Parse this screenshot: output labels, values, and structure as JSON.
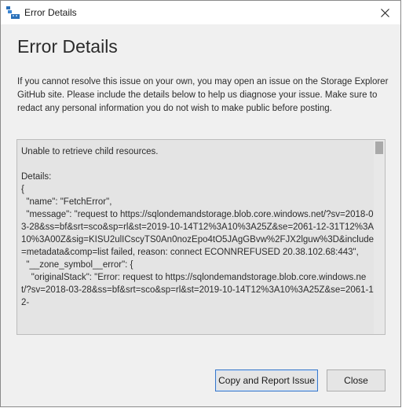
{
  "window": {
    "title": "Error Details"
  },
  "dialog": {
    "heading": "Error Details",
    "intro": "If you cannot resolve this issue on your own, you may open an issue on the Storage Explorer GitHub site. Please include the details below to help us diagnose your issue. Make sure to redact any personal information you do not wish to make public before posting.",
    "details_text": "Unable to retrieve child resources.\n\nDetails:\n{\n  \"name\": \"FetchError\",\n  \"message\": \"request to https://sqlondemandstorage.blob.core.windows.net/?sv=2018-03-28&ss=bf&srt=sco&sp=rl&st=2019-10-14T12%3A10%3A25Z&se=2061-12-31T12%3A10%3A00Z&sig=KISU2ulICscyTS0An0nozEpo4tO5JAgGBvw%2FJX2lguw%3D&include=metadata&comp=list failed, reason: connect ECONNREFUSED 20.38.102.68:443\",\n  \"__zone_symbol__error\": {\n    \"originalStack\": \"Error: request to https://sqlondemandstorage.blob.core.windows.net/?sv=2018-03-28&ss=bf&srt=sco&sp=rl&st=2019-10-14T12%3A10%3A25Z&se=2061-12-"
  },
  "buttons": {
    "report": "Copy and Report Issue",
    "close": "Close"
  },
  "colors": {
    "accent_border": "#3a78c9",
    "app_icon": "#2a6fb8"
  }
}
